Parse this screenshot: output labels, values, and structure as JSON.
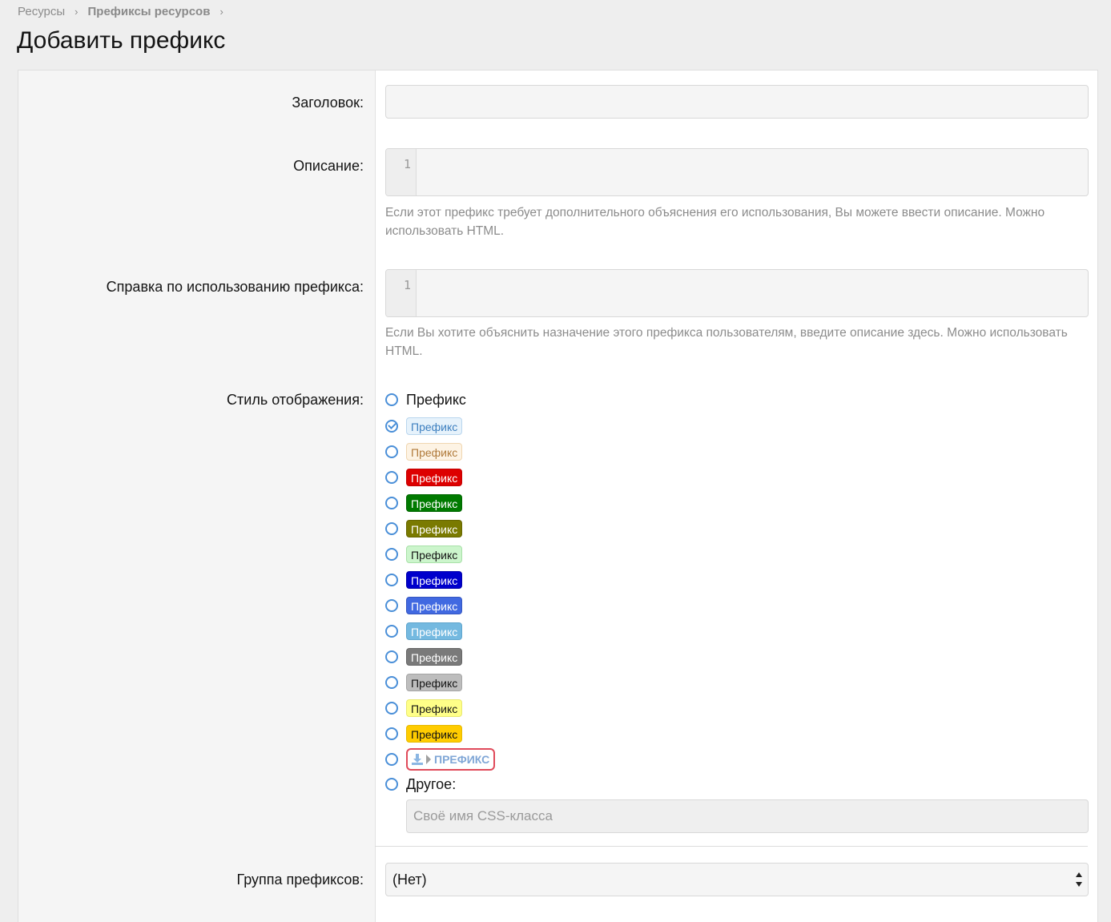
{
  "breadcrumb": {
    "items": [
      "Ресурсы",
      "Префиксы ресурсов"
    ],
    "separator": "›"
  },
  "page": {
    "title": "Добавить префикс"
  },
  "form": {
    "title_label": "Заголовок:",
    "title_value": "",
    "description_label": "Описание:",
    "description_line": "1",
    "description_hint": "Если этот префикс требует дополнительного объяснения его использования, Вы можете ввести описание. Можно использовать HTML.",
    "usage_label": "Справка по использованию префикса:",
    "usage_line": "1",
    "usage_hint": "Если Вы хотите объяснить назначение этого префикса пользователям, введите описание здесь. Можно использовать HTML.",
    "style_label": "Стиль отображения:",
    "style_plain_label": "Префикс",
    "styles": [
      {
        "text": "Префикс",
        "bg": "#e6f2fb",
        "fg": "#3d7fbf",
        "border": "#b9d6ee",
        "checked": true
      },
      {
        "text": "Префикс",
        "bg": "#fdf3e4",
        "fg": "#b07a3a",
        "border": "#f0d6b0",
        "checked": false
      },
      {
        "text": "Префикс",
        "bg": "#dd0000",
        "fg": "#ffffff",
        "border": "#c40000",
        "checked": false
      },
      {
        "text": "Префикс",
        "bg": "#007a00",
        "fg": "#ffffff",
        "border": "#006600",
        "checked": false
      },
      {
        "text": "Префикс",
        "bg": "#7a7a00",
        "fg": "#ffffff",
        "border": "#666600",
        "checked": false
      },
      {
        "text": "Префикс",
        "bg": "#ccf5cc",
        "fg": "#141414",
        "border": "#a8e0a8",
        "checked": false
      },
      {
        "text": "Префикс",
        "bg": "#0000cc",
        "fg": "#ffffff",
        "border": "#0000aa",
        "checked": false
      },
      {
        "text": "Префикс",
        "bg": "#4169e1",
        "fg": "#ffffff",
        "border": "#3556c0",
        "checked": false
      },
      {
        "text": "Префикс",
        "bg": "#74b9e0",
        "fg": "#ffffff",
        "border": "#5fa5cd",
        "checked": false
      },
      {
        "text": "Префикс",
        "bg": "#7a7a7a",
        "fg": "#ffffff",
        "border": "#666666",
        "checked": false
      },
      {
        "text": "Префикс",
        "bg": "#bdbdbd",
        "fg": "#141414",
        "border": "#a5a5a5",
        "checked": false
      },
      {
        "text": "Префикс",
        "bg": "#ffff88",
        "fg": "#141414",
        "border": "#e8e870",
        "checked": false
      },
      {
        "text": "Префикс",
        "bg": "#ffcc00",
        "fg": "#141414",
        "border": "#e6b800",
        "checked": false
      }
    ],
    "special_prefix_text": "ПРЕФИКС",
    "special_icon": "download-icon",
    "other_label": "Другое:",
    "custom_class_placeholder": "Своё имя CSS-класса",
    "group_label": "Группа префиксов:",
    "group_value": "(Нет)"
  }
}
